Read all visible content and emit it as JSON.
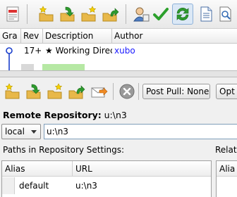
{
  "log": {
    "columns": {
      "graph": "Gra",
      "rev": "Rev",
      "description": "Description",
      "author": "Author"
    },
    "rows": [
      {
        "rev": "17+",
        "description": "★ Working Direc",
        "author": "xubo"
      }
    ]
  },
  "sync": {
    "post_pull_label": "Post Pull: None",
    "options_label": "Opt",
    "remote_label": "Remote Repository:",
    "remote_value": "u:\\n3",
    "source_combo": "local",
    "path_value": "u:\\n3",
    "paths_label": "Paths in Repository Settings:",
    "related_label": "Relat",
    "paths_table": {
      "col_alias": "Alias",
      "col_url": "URL",
      "rows": [
        {
          "alias": "default",
          "url": "u:\\n3"
        }
      ]
    },
    "related_table": {
      "col_alias": "Alia"
    }
  },
  "colors": {
    "accent": "#3a7bd5",
    "author": "#1a1aff",
    "check": "#2ca02c",
    "folder": "#e8b84a"
  }
}
